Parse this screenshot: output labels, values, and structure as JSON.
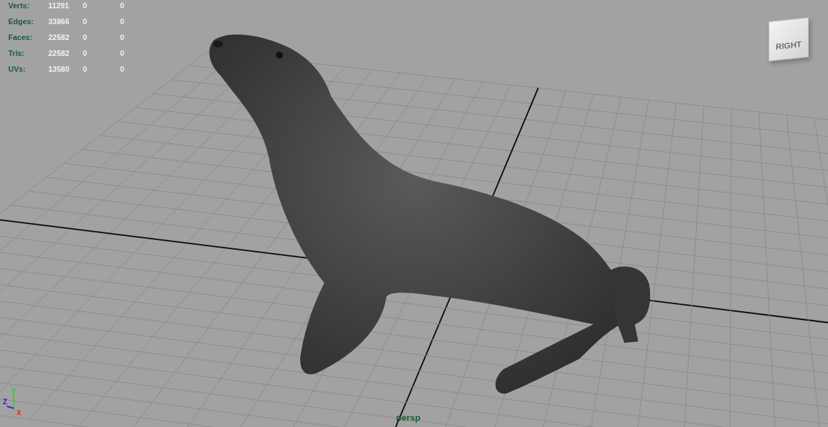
{
  "stats": [
    {
      "label": "Verts:",
      "values": [
        "11291",
        "0",
        "0"
      ]
    },
    {
      "label": "Edges:",
      "values": [
        "33866",
        "0",
        "0"
      ]
    },
    {
      "label": "Faces:",
      "values": [
        "22582",
        "0",
        "0"
      ]
    },
    {
      "label": "Tris:",
      "values": [
        "22582",
        "0",
        "0"
      ]
    },
    {
      "label": "UVs:",
      "values": [
        "13580",
        "0",
        "0"
      ]
    }
  ],
  "view_cube": {
    "face_label": "RIGHT"
  },
  "axis_gizmo": {
    "x": "X",
    "y": "Y",
    "z": "Z"
  },
  "camera_label": "persp"
}
